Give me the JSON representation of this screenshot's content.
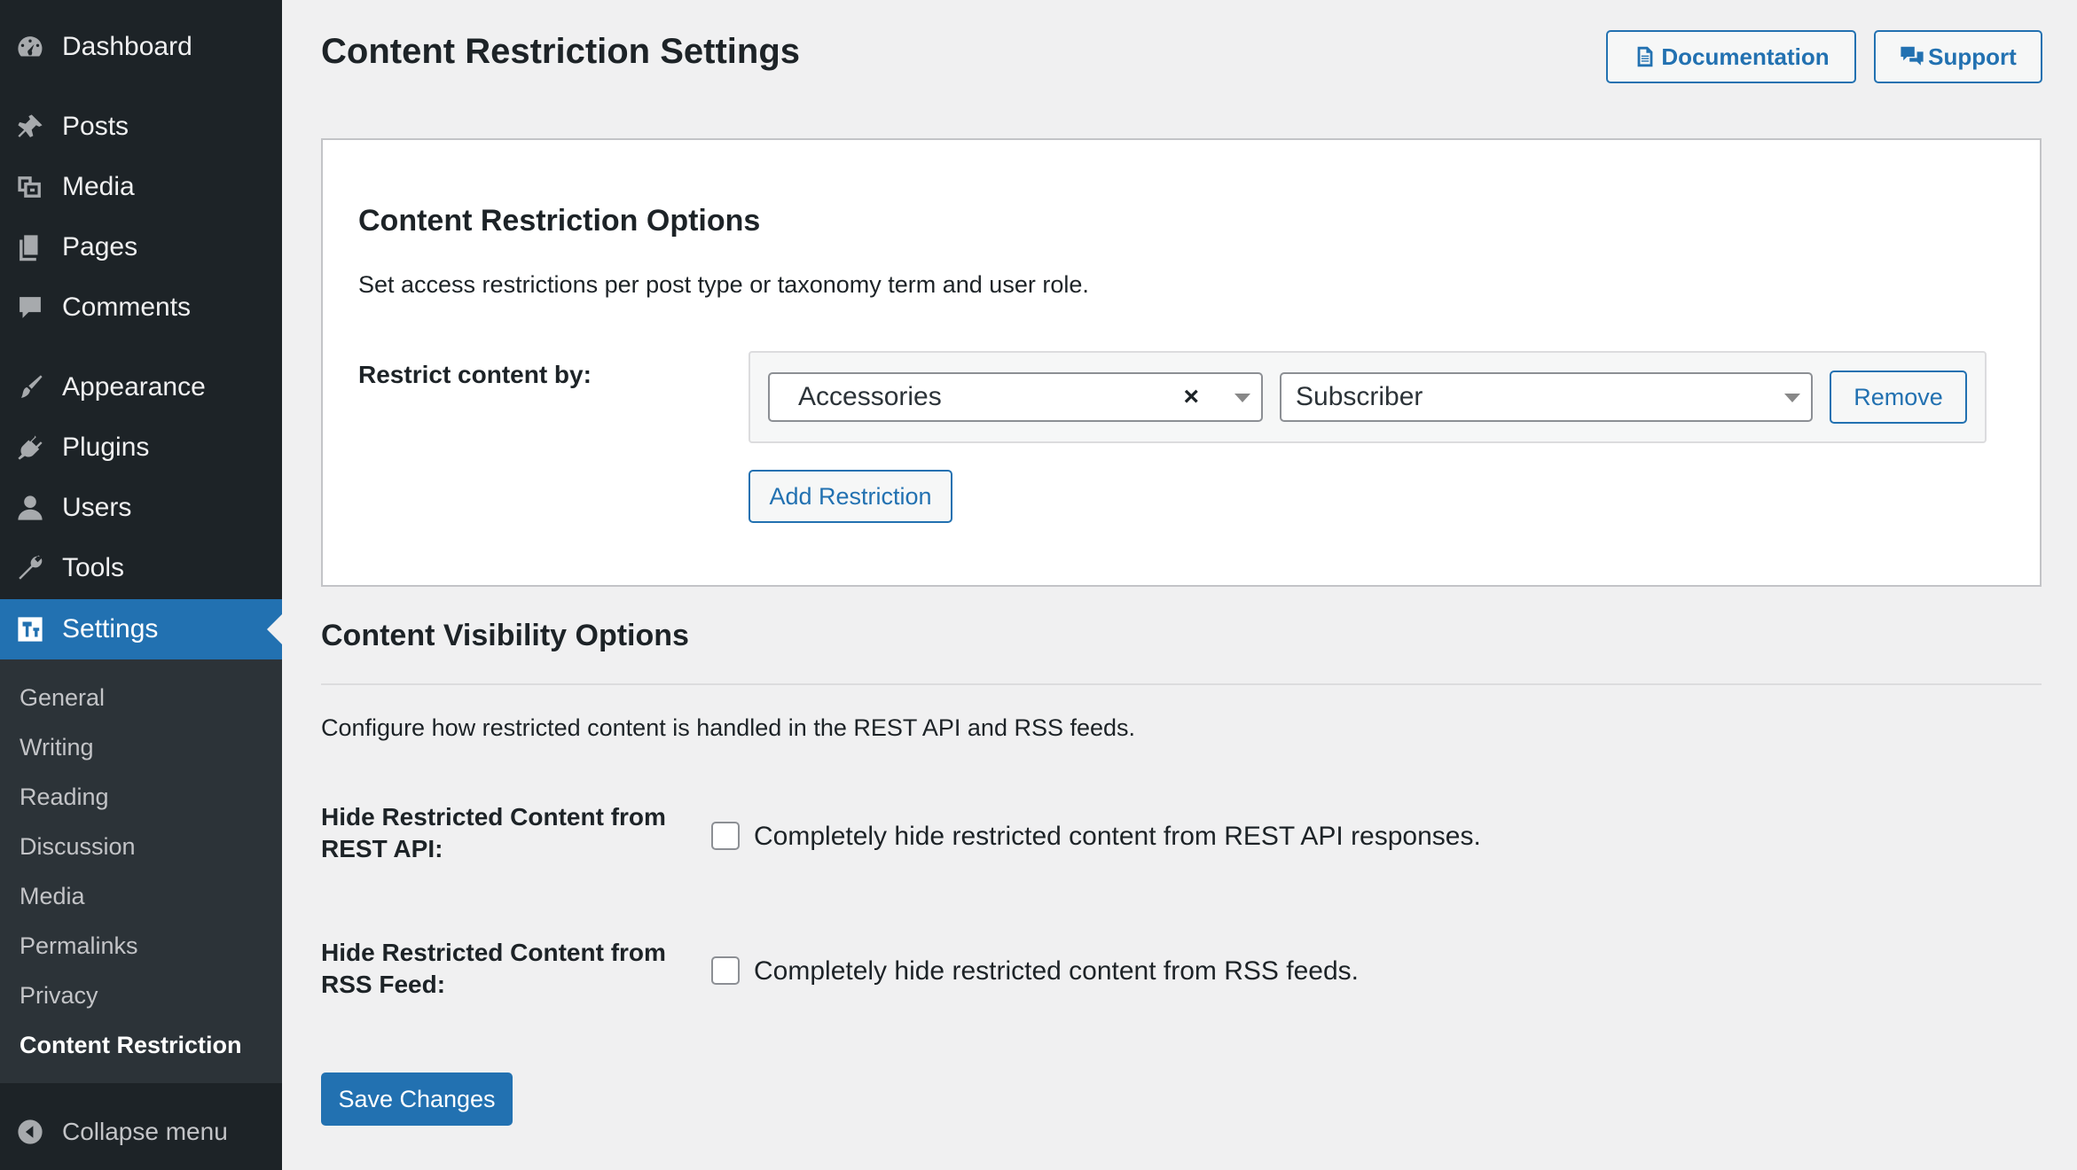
{
  "sidebar": {
    "items": [
      {
        "label": "Dashboard",
        "icon": "dashboard-icon"
      },
      {
        "label": "Posts",
        "icon": "pin-icon"
      },
      {
        "label": "Media",
        "icon": "media-icon"
      },
      {
        "label": "Pages",
        "icon": "pages-icon"
      },
      {
        "label": "Comments",
        "icon": "comment-icon"
      },
      {
        "label": "Appearance",
        "icon": "paintbrush-icon"
      },
      {
        "label": "Plugins",
        "icon": "plugin-icon"
      },
      {
        "label": "Users",
        "icon": "user-icon"
      },
      {
        "label": "Tools",
        "icon": "wrench-icon"
      },
      {
        "label": "Settings",
        "icon": "settings-icon",
        "active": true
      }
    ],
    "submenu": [
      "General",
      "Writing",
      "Reading",
      "Discussion",
      "Media",
      "Permalinks",
      "Privacy",
      "Content Restriction"
    ],
    "current_submenu": "Content Restriction",
    "collapse_label": "Collapse menu"
  },
  "header": {
    "title": "Content Restriction Settings",
    "documentation_label": "Documentation",
    "support_label": "Support"
  },
  "restriction_options": {
    "heading": "Content Restriction Options",
    "description": "Set access restrictions per post type or taxonomy term and user role.",
    "field_label": "Restrict content by:",
    "rows": [
      {
        "term": "Accessories",
        "role": "Subscriber",
        "remove_label": "Remove"
      }
    ],
    "add_label": "Add Restriction"
  },
  "visibility_options": {
    "heading": "Content Visibility Options",
    "description": "Configure how restricted content is handled in the REST API and RSS feeds.",
    "rest": {
      "label_line1": "Hide Restricted Content from",
      "label_line2": "REST API:",
      "checkbox_label": "Completely hide restricted content from REST API responses.",
      "checked": false
    },
    "rss": {
      "label_line1": "Hide Restricted Content from",
      "label_line2": "RSS Feed:",
      "checkbox_label": "Completely hide restricted content from RSS feeds.",
      "checked": false
    }
  },
  "save_label": "Save Changes",
  "colors": {
    "sidebar_bg": "#1d2327",
    "submenu_bg": "#2c3338",
    "accent": "#2271b1",
    "page_bg": "#f0f0f1"
  }
}
